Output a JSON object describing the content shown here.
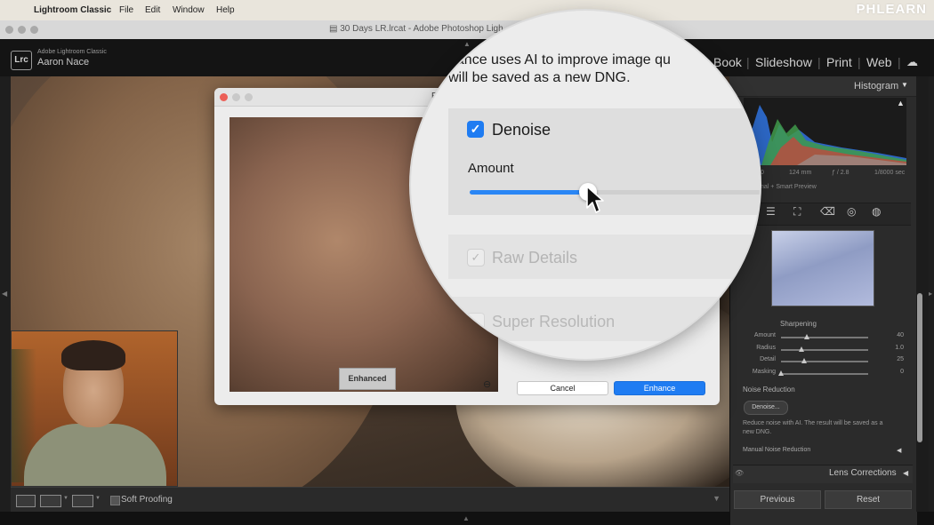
{
  "menubar": {
    "apple_glyph": "",
    "app": "Lightroom Classic",
    "items": [
      "File",
      "Edit",
      "Window",
      "Help"
    ],
    "watermark": "PHLEARN"
  },
  "window": {
    "title": "30 Days LR.lrcat - Adobe Photoshop Ligh"
  },
  "identity": {
    "logo": "Lrc",
    "app_name": "Adobe Lightroom Classic",
    "user": "Aaron Nace"
  },
  "modules": [
    "Book",
    "Slideshow",
    "Print",
    "Web"
  ],
  "toolbar": {
    "soft_proofing": "Soft Proofing"
  },
  "histogram": {
    "title": "Histogram",
    "meta": [
      "0",
      "124 mm",
      "ƒ / 2.8",
      "1/8000 sec"
    ],
    "preview_note": "nal + Smart Preview"
  },
  "sharpening": {
    "title": "Sharpening",
    "rows": [
      {
        "label": "Amount",
        "value": "40",
        "frac": 0.3
      },
      {
        "label": "Radius",
        "value": "1.0",
        "frac": 0.23
      },
      {
        "label": "Detail",
        "value": "25",
        "frac": 0.27
      },
      {
        "label": "Masking",
        "value": "0",
        "frac": 0.0
      }
    ]
  },
  "noise_reduction": {
    "title": "Noise Reduction",
    "denoise_button": "Denoise...",
    "description": "Reduce noise with AI. The result will be saved as a new DNG.",
    "manual": "Manual Noise Reduction"
  },
  "lens_corrections": {
    "label": "Lens Corrections"
  },
  "panel_buttons": {
    "previous": "Previous",
    "reset": "Reset"
  },
  "dialog": {
    "title_fragment": "E",
    "enhanced_badge": "Enhanced",
    "cancel": "Cancel",
    "enhance": "Enhance"
  },
  "magnifier": {
    "desc_line1": "hance uses AI to improve image qu",
    "desc_line2": "will be saved as a new DNG.",
    "denoise_label": "Denoise",
    "denoise_checked": true,
    "amount_label": "Amount",
    "amount_fraction": 0.39,
    "raw_details_label": "Raw Details",
    "super_resolution_label": "Super Resolution"
  },
  "colors": {
    "accent_blue": "#1f7cf2",
    "panel_bg": "#2b2b2b"
  }
}
